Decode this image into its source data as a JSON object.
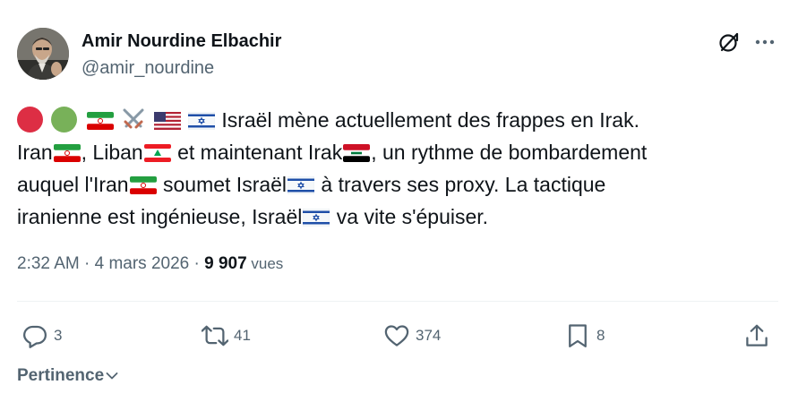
{
  "author": {
    "name": "Amir Nourdine Elbachir",
    "handle": "@amir_nourdine",
    "avatar_icon": "profile-photo"
  },
  "tweet": {
    "line1_text": "Israël mène actuellement des frappes en Irak.",
    "line2_a": "Iran",
    "line2_b": ", Liban",
    "line2_c": " et maintenant Irak",
    "line2_d": ", un rythme de bombardement",
    "line3_a": "auquel l'Iran",
    "line3_b": " soumet Israël",
    "line3_c": " à travers ses proxy. La tactique",
    "line4_a": "iranienne est ingénieuse, Israël",
    "line4_b": " va vite s'épuiser.",
    "emojis": [
      "red-circle",
      "green-circle",
      "iran-flag",
      "crossed-swords",
      "us-flag",
      "israel-flag",
      "lebanon-flag",
      "iraq-flag"
    ]
  },
  "meta": {
    "time": "2:32 AM",
    "sep1": " · ",
    "date": "4 mars 2026",
    "sep2": " · ",
    "views_count": "9 907",
    "views_label": " vues"
  },
  "actions": {
    "replies": "3",
    "reposts": "41",
    "likes": "374",
    "bookmarks": "8"
  },
  "sort": {
    "label": "Pertinence"
  },
  "colors": {
    "text": "#0f1419",
    "secondary": "#536471",
    "divider": "#eff3f4"
  }
}
